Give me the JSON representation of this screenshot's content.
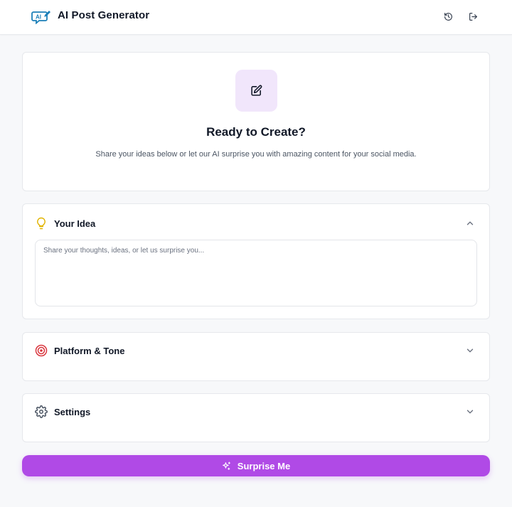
{
  "header": {
    "logo_text": "AI",
    "title": "AI Post Generator",
    "history_icon": "history-icon",
    "logout_icon": "logout-icon"
  },
  "hero": {
    "icon": "edit-icon",
    "title": "Ready to Create?",
    "subtitle": "Share your ideas below or let our AI surprise you with amazing content for your social media."
  },
  "sections": {
    "idea": {
      "icon": "lightbulb-icon",
      "label": "Your Idea",
      "expanded": true,
      "placeholder": "Share your thoughts, ideas, or let us surprise you...",
      "value": ""
    },
    "platform": {
      "icon": "target-icon",
      "label": "Platform & Tone",
      "expanded": false
    },
    "settings": {
      "icon": "gear-icon",
      "label": "Settings",
      "expanded": false
    }
  },
  "action": {
    "icon": "sparkles-icon",
    "label": "Surprise Me"
  },
  "colors": {
    "accent": "#b04ae6",
    "accent_soft": "#f1e6fb",
    "logo": "#1b7fb8",
    "idea_icon": "#e1b400",
    "target_icon": "#d9363e"
  }
}
